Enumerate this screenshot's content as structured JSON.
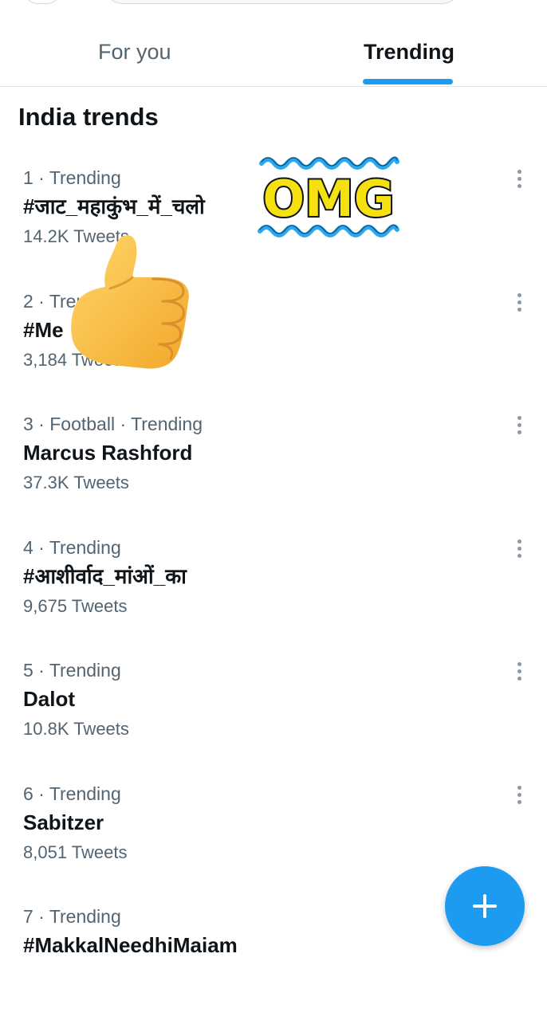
{
  "tabs": [
    {
      "label": "For you",
      "selected": false
    },
    {
      "label": "Trending",
      "selected": true
    }
  ],
  "section_title": "India trends",
  "trends": [
    {
      "meta": "1 · Trending",
      "name": "#जाट_महाकुंभ_में_चलो",
      "count": "14.2K Tweets"
    },
    {
      "meta": "2 · Trending",
      "name": "#Me",
      "count": "3,184 Tweets"
    },
    {
      "meta": "3 · Football · Trending",
      "name": "Marcus Rashford",
      "count": "37.3K Tweets"
    },
    {
      "meta": "4 · Trending",
      "name": "#आशीर्वाद_मांओं_का",
      "count": "9,675 Tweets"
    },
    {
      "meta": "5 · Trending",
      "name": "Dalot",
      "count": "10.8K Tweets"
    },
    {
      "meta": "6 · Trending",
      "name": "Sabitzer",
      "count": "8,051 Tweets"
    },
    {
      "meta": "7 · Trending",
      "name": "#MakkalNeedhiMaiam",
      "count": ""
    }
  ],
  "stickers": {
    "omg_text": "OMG",
    "thumbs_up": "thumbs-up-icon"
  },
  "icons": {
    "more": "more-vertical-icon",
    "compose": "plus-icon"
  },
  "colors": {
    "accent": "#1d9bf0",
    "secondary_text": "#536471",
    "primary_text": "#0f1419",
    "omg_fill": "#f5e10f",
    "omg_wave": "#2aa8f2"
  }
}
